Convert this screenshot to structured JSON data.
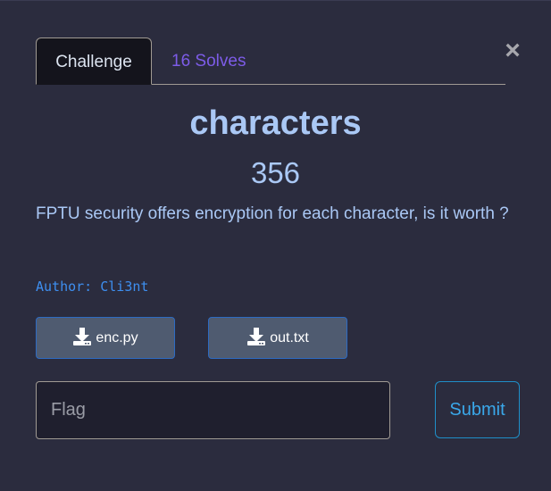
{
  "tabs": {
    "challenge_label": "Challenge",
    "solves_label": "16 Solves"
  },
  "close_symbol": "×",
  "challenge": {
    "name": "characters",
    "points": "356",
    "description": "FPTU security offers encryption for each character, is it worth ?",
    "author": "Author: Cli3nt"
  },
  "files": [
    {
      "name": "enc.py",
      "icon": "download-icon"
    },
    {
      "name": "out.txt",
      "icon": "download-icon"
    }
  ],
  "flag_input": {
    "placeholder": "Flag",
    "value": ""
  },
  "submit_label": "Submit",
  "colors": {
    "background": "#2b2c3e",
    "title": "#aac8f5",
    "solves_tab": "#7d5ce8",
    "author": "#3e8ff0",
    "submit": "#3aa8ea"
  }
}
